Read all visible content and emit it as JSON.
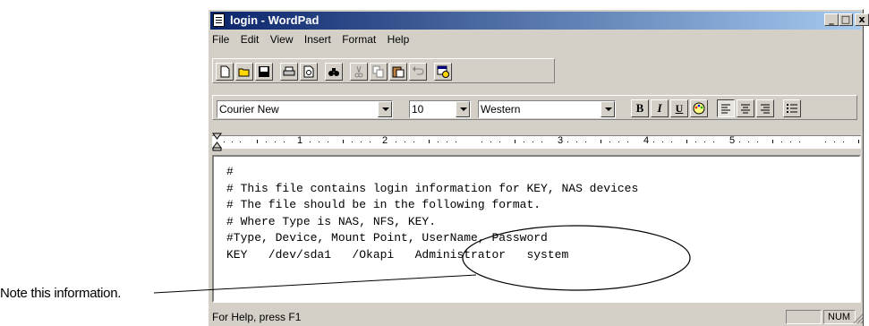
{
  "window": {
    "title": "login - WordPad",
    "controls": {
      "minimize": "_",
      "maximize": "□",
      "close": "x"
    }
  },
  "menu": [
    "File",
    "Edit",
    "View",
    "Insert",
    "Format",
    "Help"
  ],
  "format_bar": {
    "font": "Courier New",
    "size": "10",
    "script": "Western",
    "bold": "B",
    "italic": "I",
    "underline": "U"
  },
  "ruler": {
    "marks": [
      "1",
      "2",
      "3",
      "4",
      "5"
    ]
  },
  "document": {
    "lines": [
      "#",
      "# This file contains login information for KEY, NAS devices",
      "# The file should be in the following format.",
      "# Where Type is NAS, NFS, KEY.",
      "#Type, Device, Mount Point, UserName, Password",
      "KEY   /dev/sda1   /Okapi   Administrator   system"
    ]
  },
  "status": {
    "help": "For Help, press F1",
    "num": "NUM"
  },
  "annotation": {
    "callout": "Note this information."
  }
}
